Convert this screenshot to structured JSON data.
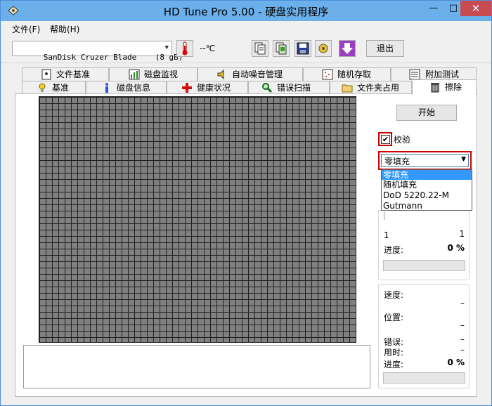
{
  "window": {
    "title": "HD Tune Pro 5.00 - 硬盘实用程序",
    "min_glyph": "—",
    "max_glyph": "□",
    "close_glyph": "✕"
  },
  "menu": {
    "file": "文件(F)",
    "help": "帮助(H)"
  },
  "toolbar": {
    "drive": "SanDisk Cruzer Blade    (8 gB)",
    "temperature": "--℃",
    "exit": "退出"
  },
  "tabs_row1": [
    {
      "label": "文件基准",
      "icon": "file-benchmark-icon"
    },
    {
      "label": "磁盘监视",
      "icon": "disk-monitor-icon"
    },
    {
      "label": "自动噪音管理",
      "icon": "speaker-icon"
    },
    {
      "label": "随机存取",
      "icon": "random-access-icon"
    },
    {
      "label": "附加测试",
      "icon": "extra-tests-icon"
    }
  ],
  "tabs_row2": [
    {
      "label": "基准",
      "icon": "benchmark-icon"
    },
    {
      "label": "磁盘信息",
      "icon": "info-icon"
    },
    {
      "label": "健康状况",
      "icon": "health-cross-icon"
    },
    {
      "label": "错误扫描",
      "icon": "magnifier-icon"
    },
    {
      "label": "文件夹占用",
      "icon": "folder-icon"
    },
    {
      "label": "擦除",
      "icon": "trash-icon"
    }
  ],
  "erase": {
    "start_button": "开始",
    "verify_label": "校验",
    "verify_checked": true,
    "fill_selected": "零填充",
    "fill_options": [
      "零填充",
      "随机填充",
      "DoD 5220.22-M",
      "Gutmann"
    ],
    "pass_left": "1",
    "pass_right": "1",
    "progress_label": "进度:",
    "progress_value": "0 %",
    "speed_label": "速度:",
    "speed_value": "–",
    "position_label": "位置:",
    "position_value": "–",
    "errors_label": "错误:",
    "errors_value": "–",
    "elapsed_label": "用时:",
    "elapsed_value": "–",
    "progress2_label": "进度:",
    "progress2_value": "0 %"
  },
  "colors": {
    "titlebar": "#6bb0ea",
    "close_button": "#c74b50",
    "highlight_border": "#d00000",
    "selection": "#3399ff",
    "block_grid": "#808080"
  }
}
